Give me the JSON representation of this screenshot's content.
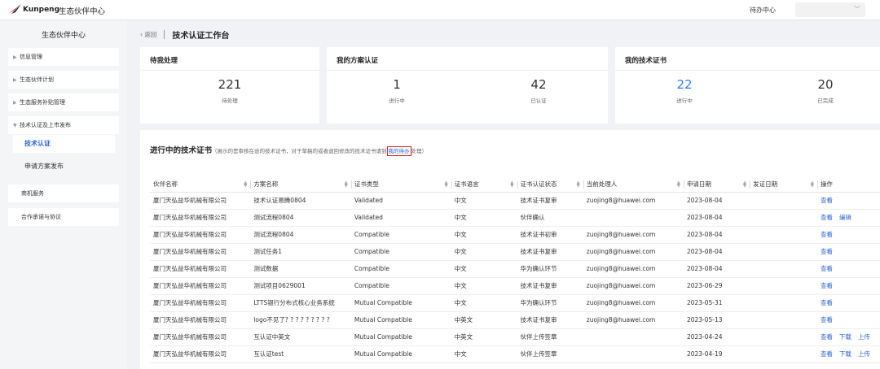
{
  "topbar": {
    "logo_text": "Kunpeng",
    "title": "生态伙伴中心",
    "todo_center": "待办中心"
  },
  "sidebar": {
    "title": "生态伙伴中心",
    "items": [
      {
        "label": "信息管理"
      },
      {
        "label": "生态伙伴计划"
      },
      {
        "label": "生态服务补贴管理"
      },
      {
        "label": "技术认证及上市发布"
      }
    ],
    "sub_items": [
      {
        "label": "技术认证"
      },
      {
        "label": "申请方案发布"
      }
    ],
    "plain_items": [
      {
        "label": "商机服务"
      },
      {
        "label": "合作承诺与协议"
      }
    ]
  },
  "header": {
    "back": "返回",
    "title": "技术认证工作台"
  },
  "cards": {
    "pending": {
      "title": "待我处理",
      "value": "221",
      "label": "待处理"
    },
    "solution": {
      "title": "我的方案认证",
      "v1": "1",
      "l1": "进行中",
      "v2": "42",
      "l2": "已认证"
    },
    "cert": {
      "title": "我的技术证书",
      "v1": "22",
      "l1": "进行中",
      "v2": "20",
      "l2": "已完成"
    }
  },
  "panel": {
    "title": "进行中的技术证书",
    "note_pre": "（展示的是审核在途的技术证书，对于草稿的或者退回修改的技术证书请到",
    "note_link": "我的待办",
    "note_post": "处理）"
  },
  "table": {
    "headers": [
      "伙伴名称",
      "方案名称",
      "证书类型",
      "证书语言",
      "证书认证状态",
      "当前处理人",
      "申请日期",
      "发证日期",
      "操作"
    ],
    "rows": [
      {
        "partner": "厦门天弘益华机械有限公司",
        "solution": "技术认证易腾0804",
        "type": "Validated",
        "lang": "中文",
        "status": "技术证书复审",
        "handler": "zuojing8@huawei.com",
        "apply": "2023-08-04",
        "issue": "",
        "ops": [
          "查看"
        ]
      },
      {
        "partner": "厦门天弘益华机械有限公司",
        "solution": "测试流程0804",
        "type": "Validated",
        "lang": "中文",
        "status": "伙伴确认",
        "handler": "",
        "apply": "2023-08-04",
        "issue": "",
        "ops": [
          "查看",
          "编辑"
        ]
      },
      {
        "partner": "厦门天弘益华机械有限公司",
        "solution": "测试流程0804",
        "type": "Compatible",
        "lang": "中文",
        "status": "技术证书初审",
        "handler": "zuojing8@huawei.com",
        "apply": "2023-08-04",
        "issue": "",
        "ops": [
          "查看"
        ]
      },
      {
        "partner": "厦门天弘益华机械有限公司",
        "solution": "测试任务1",
        "type": "Compatible",
        "lang": "中文",
        "status": "技术证书复审",
        "handler": "zuojing8@huawei.com",
        "apply": "2023-08-04",
        "issue": "",
        "ops": [
          "查看"
        ]
      },
      {
        "partner": "厦门天弘益华机械有限公司",
        "solution": "测试数据",
        "type": "Compatible",
        "lang": "中文",
        "status": "华为确认环节",
        "handler": "zuojing8@huawei.com",
        "apply": "2023-08-04",
        "issue": "",
        "ops": [
          "查看"
        ]
      },
      {
        "partner": "厦门天弘益华机械有限公司",
        "solution": "测试项目0629001",
        "type": "Compatible",
        "lang": "中文",
        "status": "技术证书复审",
        "handler": "zuojing8@huawei.com",
        "apply": "2023-06-29",
        "issue": "",
        "ops": [
          "查看"
        ]
      },
      {
        "partner": "厦门天弘益华机械有限公司",
        "solution": "LTTS银行分布式核心业务系统",
        "type": "Mutual Compatible",
        "lang": "中文",
        "status": "华为确认环节",
        "handler": "zuojing8@huawei.com",
        "apply": "2023-05-31",
        "issue": "",
        "ops": [
          "查看"
        ]
      },
      {
        "partner": "厦门天弘益华机械有限公司",
        "solution": "logo不见了? ? ? ? ? ? ? ? ?",
        "type": "Mutual Compatible",
        "lang": "中英文",
        "status": "技术证书复审",
        "handler": "zuojing8@huawei.com",
        "apply": "2023-05-13",
        "issue": "",
        "ops": [
          "查看"
        ]
      },
      {
        "partner": "厦门天弘益华机械有限公司",
        "solution": "互认证中英文",
        "type": "Mutual Compatible",
        "lang": "中英文",
        "status": "伙伴上传签章",
        "handler": "",
        "apply": "2023-04-24",
        "issue": "",
        "ops": [
          "查看",
          "下载",
          "上传"
        ]
      },
      {
        "partner": "厦门天弘益华机械有限公司",
        "solution": "互认证test",
        "type": "Mutual Compatible",
        "lang": "中文",
        "status": "伙伴上传签章",
        "handler": "",
        "apply": "2023-04-19",
        "issue": "",
        "ops": [
          "查看",
          "下载",
          "上传"
        ]
      }
    ]
  },
  "colors": {
    "accent": "#2c64d8",
    "stat_blue": "#2f7df5",
    "highlight_border": "#e02020"
  }
}
